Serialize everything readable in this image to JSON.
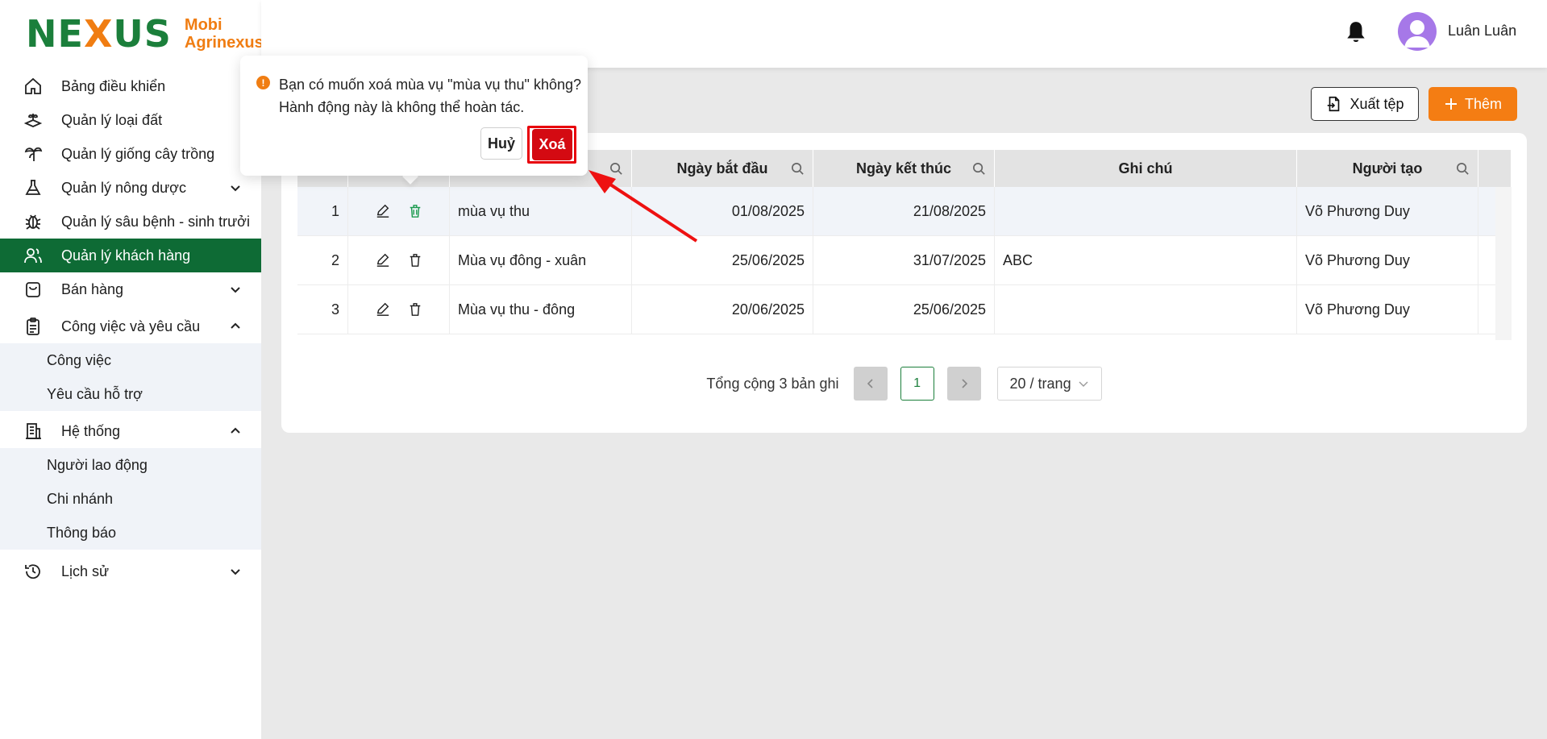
{
  "brand": {
    "mark": "NEXUS",
    "line1": "Mobi",
    "line2": "Agrinexus"
  },
  "sidebar": {
    "items": [
      {
        "label": "Bảng điều khiển",
        "icon": "home-icon"
      },
      {
        "label": "Quản lý loại đất",
        "icon": "soil-icon"
      },
      {
        "label": "Quản lý giống cây trồng",
        "icon": "plant-icon"
      },
      {
        "label": "Quản lý nông dược",
        "icon": "flask-icon"
      },
      {
        "label": "Quản lý sâu bệnh - sinh trưởi",
        "icon": "bug-icon"
      },
      {
        "label": "Quản lý khách hàng",
        "icon": "users-icon"
      },
      {
        "label": "Bán hàng",
        "icon": "bag-icon"
      },
      {
        "label": "Công việc và yêu cầu",
        "icon": "clipboard-icon"
      },
      {
        "label": "Hệ thống",
        "icon": "building-icon"
      },
      {
        "label": "Lịch sử",
        "icon": "history-icon"
      }
    ],
    "sub_work": [
      "Công việc",
      "Yêu cầu hỗ trợ"
    ],
    "sub_system": [
      "Người lao động",
      "Chi nhánh",
      "Thông báo"
    ]
  },
  "header": {
    "username": "Luân Luân"
  },
  "toolbar": {
    "export_label": "Xuất tệp",
    "add_label": "Thêm"
  },
  "table": {
    "columns": [
      "Ngày bắt đầu",
      "Ngày kết thúc",
      "Ghi chú",
      "Người tạo"
    ],
    "rows": [
      {
        "no": "1",
        "name": "mùa vụ thu",
        "start": "01/08/2025",
        "end": "21/08/2025",
        "note": "",
        "creator": "Võ Phương Duy"
      },
      {
        "no": "2",
        "name": "Mùa vụ đông - xuân",
        "start": "25/06/2025",
        "end": "31/07/2025",
        "note": "ABC",
        "creator": "Võ Phương Duy"
      },
      {
        "no": "3",
        "name": "Mùa vụ thu - đông",
        "start": "20/06/2025",
        "end": "25/06/2025",
        "note": "",
        "creator": "Võ Phương Duy"
      }
    ]
  },
  "pagination": {
    "total": "Tổng cộng 3 bản ghi",
    "current": "1",
    "page_size": "20 / trang"
  },
  "popconfirm": {
    "line1": "Bạn có muốn xoá mùa vụ \"mùa vụ thu\" không?",
    "line2": "Hành động này là không thể hoàn tác.",
    "cancel": "Huỷ",
    "ok": "Xoá"
  },
  "colors": {
    "primary": "#0e6b35",
    "accent": "#f47d13",
    "danger": "#d40a12"
  }
}
